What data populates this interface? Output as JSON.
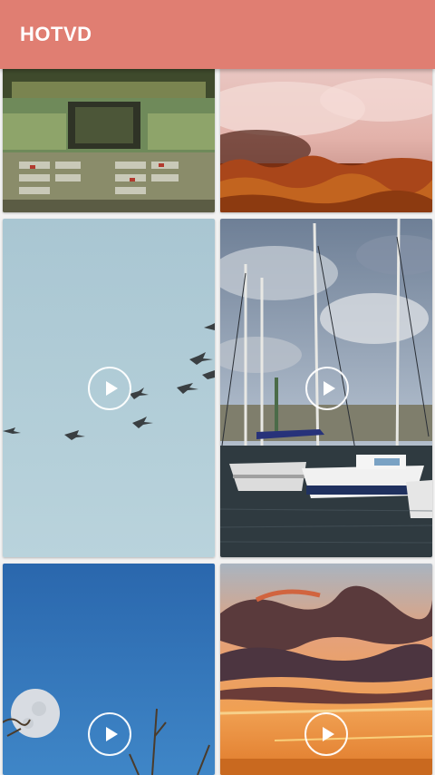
{
  "app_bar": {
    "title": "HOTVD",
    "color": "#e07e72"
  },
  "video_grid": {
    "tiles": [
      {
        "id": "parking-stadium",
        "play_icon": false
      },
      {
        "id": "pink-clouds-autumn-trees",
        "play_icon": false
      },
      {
        "id": "geese-flying-sky",
        "play_icon": true
      },
      {
        "id": "sailboats-marina",
        "play_icon": true
      },
      {
        "id": "moon-blue-sky",
        "play_icon": true
      },
      {
        "id": "orange-sunset-clouds",
        "play_icon": true
      }
    ],
    "play_icon_name": "play-icon"
  }
}
